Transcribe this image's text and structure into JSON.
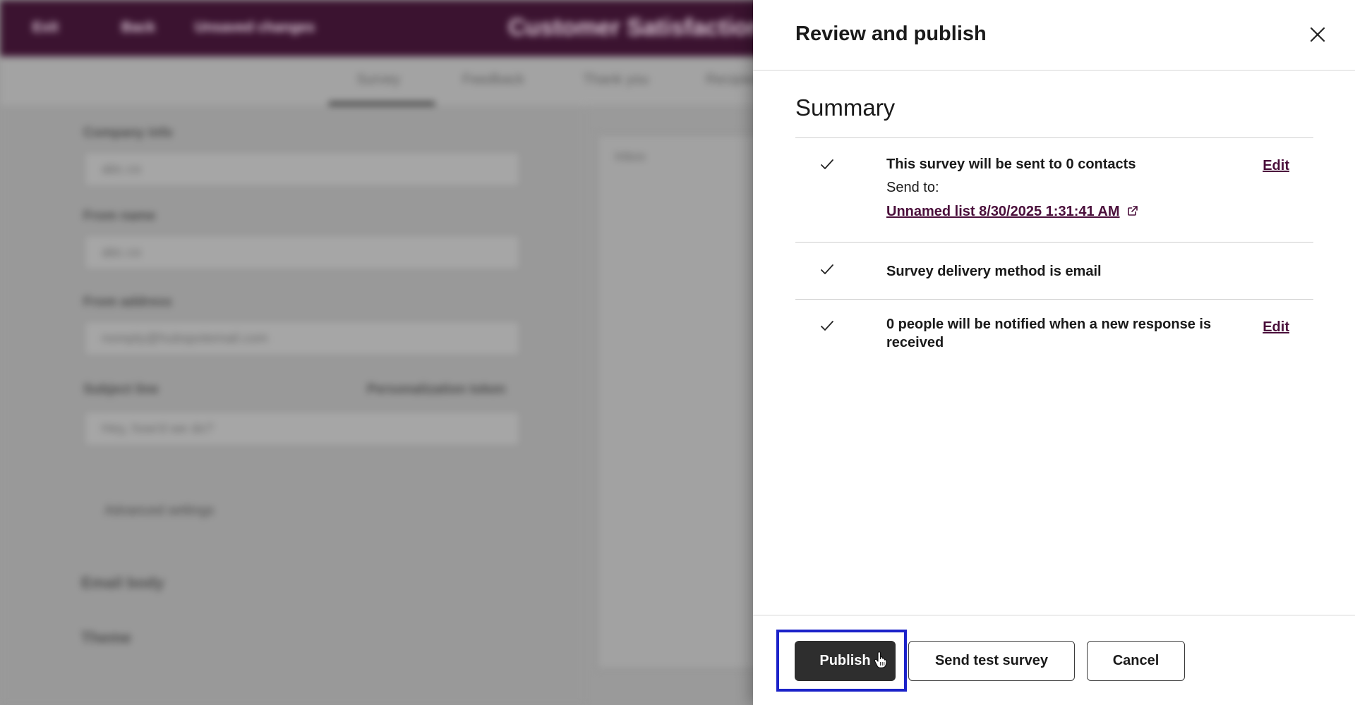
{
  "background": {
    "topbar": {
      "items": [
        "Exit",
        "Back",
        "Unsaved changes"
      ],
      "title": "Customer Satisfaction Survey"
    },
    "tabs": [
      "Survey",
      "Feedback",
      "Thank you",
      "Recipients"
    ],
    "fields": [
      {
        "label": "Company info",
        "value": "abc.co"
      },
      {
        "label": "From name",
        "value": "abc.co"
      },
      {
        "label": "From address",
        "value": "noreply@hubspotemail.com"
      },
      {
        "label": "Subject line",
        "value": "Hey, how'd we do?"
      }
    ],
    "personalization_label": "Personalization token",
    "advanced_label": "Advanced settings",
    "accordions": [
      "Email body",
      "Theme"
    ],
    "preview_label": "Inbox"
  },
  "panel": {
    "title": "Review and publish",
    "summary_title": "Summary",
    "items": [
      {
        "text": "This survey will be sent to 0 contacts",
        "sub_label": "Send to:",
        "link": "Unnamed list 8/30/2025 1:31:41 AM",
        "edit": "Edit"
      },
      {
        "text": "Survey delivery method is email"
      },
      {
        "text": "0 people will be notified when a new response is received",
        "edit": "Edit"
      }
    ],
    "buttons": {
      "publish": "Publish",
      "send_test": "Send test survey",
      "cancel": "Cancel"
    }
  },
  "colors": {
    "topbar": "#3b1330",
    "link": "#4a0f3b",
    "primary_button": "#2e2e2e",
    "highlight": "#1b22c9"
  }
}
